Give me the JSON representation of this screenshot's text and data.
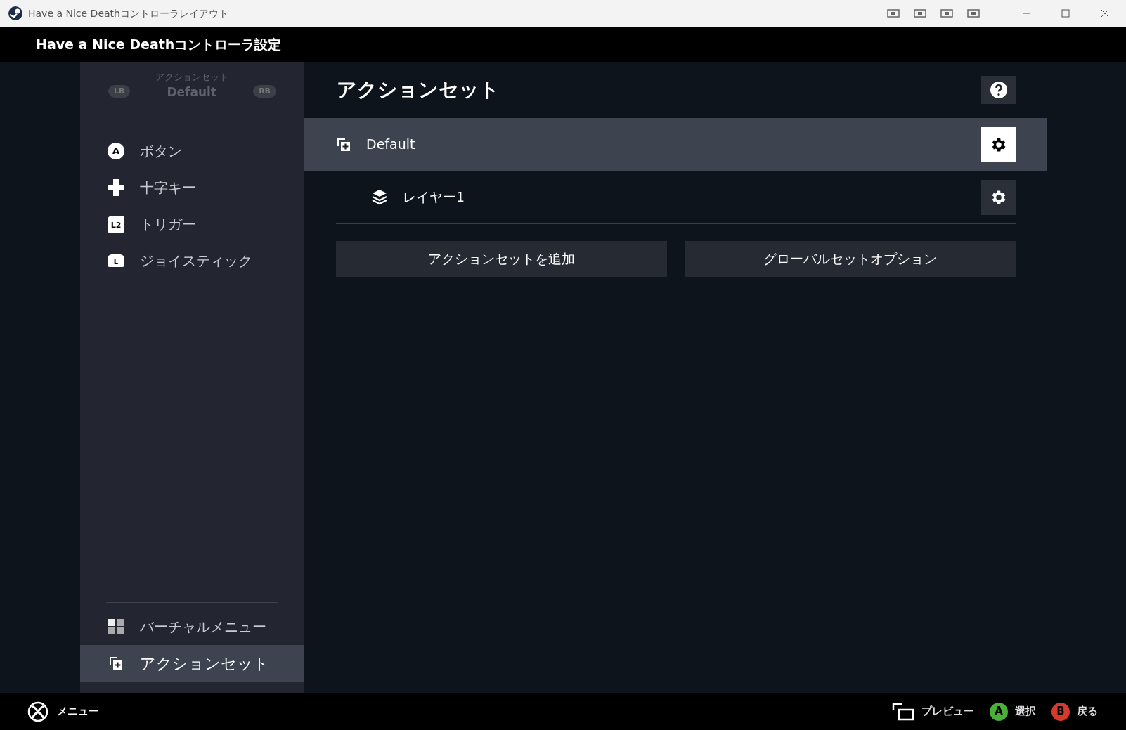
{
  "window": {
    "title": "Have a Nice Deathコントローラレイアウト"
  },
  "header": {
    "title": "Have a Nice Deathコントローラ設定"
  },
  "sidebar": {
    "set_switch": {
      "caption": "アクションセット",
      "value": "Default",
      "prev": "LB",
      "next": "RB"
    },
    "items": [
      {
        "kind": "button",
        "badge": "A",
        "label": "ボタン",
        "selected": false
      },
      {
        "kind": "dpad",
        "label": "十字キー",
        "selected": false
      },
      {
        "kind": "trigger",
        "badge": "L2",
        "label": "トリガー",
        "selected": false
      },
      {
        "kind": "joystick",
        "badge": "L",
        "label": "ジョイスティック",
        "selected": false
      }
    ],
    "bottom_items": [
      {
        "kind": "grid",
        "label": "バーチャルメニュー",
        "selected": false
      },
      {
        "kind": "sets",
        "label": "アクションセット",
        "selected": true
      }
    ]
  },
  "content": {
    "title": "アクションセット",
    "sets": [
      {
        "name": "Default",
        "selected": true,
        "children": [
          {
            "name": "レイヤー1",
            "selected": false
          }
        ]
      }
    ],
    "buttons": [
      "アクションセットを追加",
      "グローバルセットオプション"
    ]
  },
  "footer": {
    "menu": "メニュー",
    "actions": [
      {
        "kind": "preview",
        "label": "プレビュー"
      },
      {
        "kind": "glyph",
        "badge": "A",
        "color": "#4caf3a",
        "label": "選択"
      },
      {
        "kind": "glyph",
        "badge": "B",
        "color": "#d63a2a",
        "label": "戻る"
      }
    ]
  }
}
